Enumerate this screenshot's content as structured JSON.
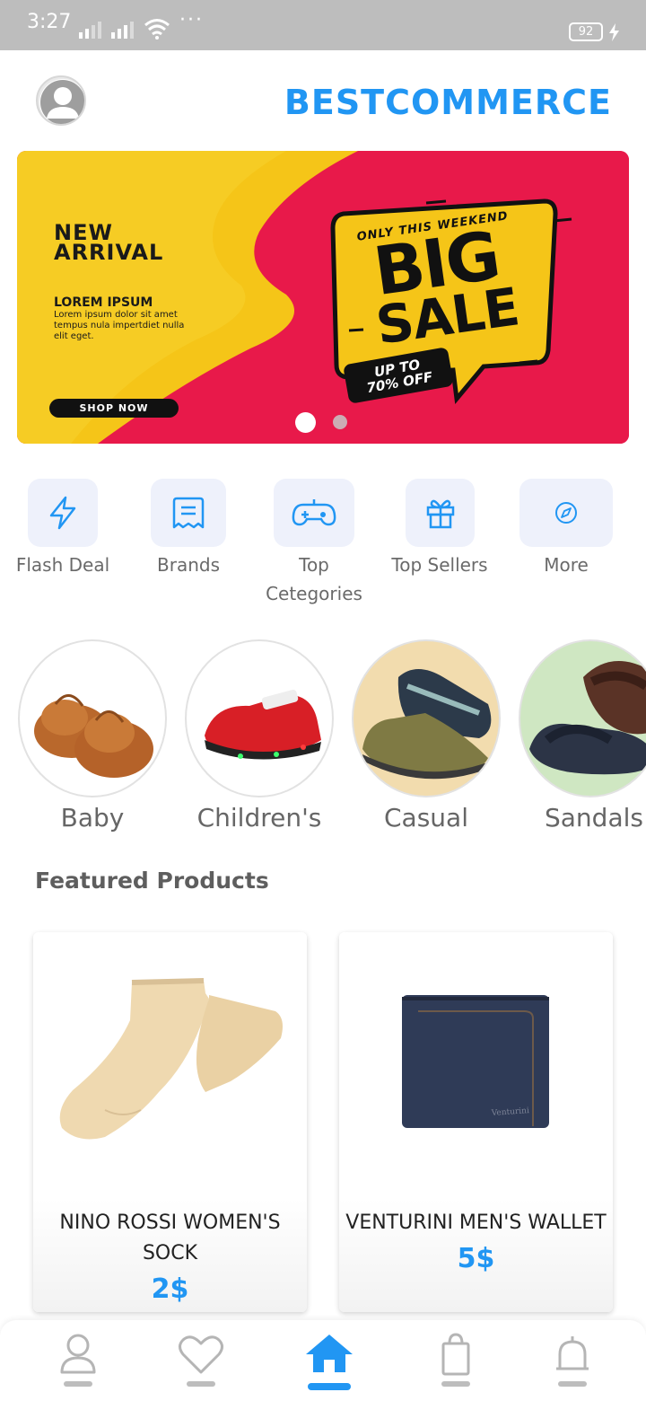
{
  "status_bar": {
    "time": "3:27",
    "dots": "···",
    "battery": "92"
  },
  "header": {
    "brand": "BESTCOMMERCE",
    "avatar_icon": "user-avatar-icon"
  },
  "banner": {
    "new_arrival_line1": "NEW",
    "new_arrival_line2": "ARRIVAL",
    "lorem_title": "LOREM IPSUM",
    "lorem_body": "Lorem ipsum dolor sit amet tempus nula impertdiet nulla elit eget.",
    "shop_now": "SHOP NOW",
    "weekend": "ONLY THIS WEEKEND",
    "big": "BIG",
    "sale": "SALE",
    "up_to": "UP TO",
    "off": "70% OFF",
    "active_slide": 1,
    "slide_count": 2
  },
  "categories": [
    {
      "label": "Flash Deal",
      "icon": "lightning-icon"
    },
    {
      "label": "Brands",
      "icon": "receipt-icon"
    },
    {
      "label_line1": "Top",
      "label_line2": "Cetegories",
      "icon": "gamepad-icon"
    },
    {
      "label": "Top Sellers",
      "icon": "gift-icon"
    },
    {
      "label": "More",
      "icon": "compass-icon"
    }
  ],
  "shoe_categories": [
    {
      "label": "Baby"
    },
    {
      "label": "Children's"
    },
    {
      "label": "Casual"
    },
    {
      "label": "Sandals"
    }
  ],
  "featured": {
    "title": "Featured Products",
    "products": [
      {
        "name_line1": "NINO ROSSI WOMEN'S",
        "name_line2": "SOCK",
        "price": "2$"
      },
      {
        "name": "VENTURINI MEN'S WALLET",
        "price": "5$"
      }
    ]
  },
  "bottom_nav": [
    {
      "icon": "profile-icon",
      "active": false
    },
    {
      "icon": "heart-icon",
      "active": false
    },
    {
      "icon": "home-icon",
      "active": true
    },
    {
      "icon": "shopping-bag-icon",
      "active": false
    },
    {
      "icon": "bell-icon",
      "active": false
    }
  ],
  "colors": {
    "accent": "#2196f3",
    "banner_yellow": "#f5c518",
    "banner_red": "#e8194a",
    "category_bg": "#eef1fb"
  }
}
